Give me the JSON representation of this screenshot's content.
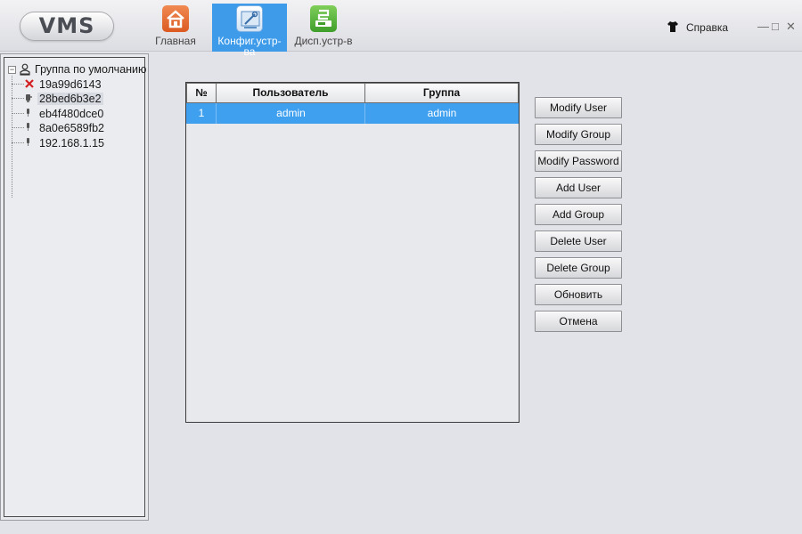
{
  "app": {
    "logo_text": "VMS",
    "nav": [
      {
        "label": "Главная",
        "icon": "home-icon"
      },
      {
        "label": "Конфиг.устр-ва",
        "icon": "device-config-icon"
      },
      {
        "label": "Дисп.устр-в",
        "icon": "device-manager-icon"
      }
    ],
    "active_nav": "Конфиг.устр-ва",
    "help_label": "Справка",
    "window_controls": {
      "minimize": "—",
      "maximize": "□",
      "close": "✕"
    }
  },
  "tree": {
    "root_label": "Группа по умолчанию",
    "expander": "⊟",
    "devices": [
      {
        "label": "19a99d6143",
        "status": "offline"
      },
      {
        "label": "28bed6b3e2",
        "status": "online",
        "selected": true
      },
      {
        "label": "eb4f480dce0",
        "status": "online"
      },
      {
        "label": "8a0e6589fb2",
        "status": "online"
      },
      {
        "label": "192.168.1.15",
        "status": "online"
      }
    ]
  },
  "users_table": {
    "columns": [
      "№",
      "Пользователь",
      "Группа"
    ],
    "rows": [
      {
        "num": "1",
        "user": "admin",
        "group": "admin"
      }
    ]
  },
  "actions": {
    "modify_user": "Modify User",
    "modify_group": "Modify Group",
    "modify_password": "Modify Password",
    "add_user": "Add User",
    "add_group": "Add Group",
    "delete_user": "Delete User",
    "delete_group": "Delete Group",
    "refresh": "Обновить",
    "cancel": "Отмена"
  },
  "colors": {
    "accent": "#3d9bea",
    "selected_row": "#3fa0f0",
    "background": "#e2e3e8",
    "offline_mark": "#d42020"
  }
}
